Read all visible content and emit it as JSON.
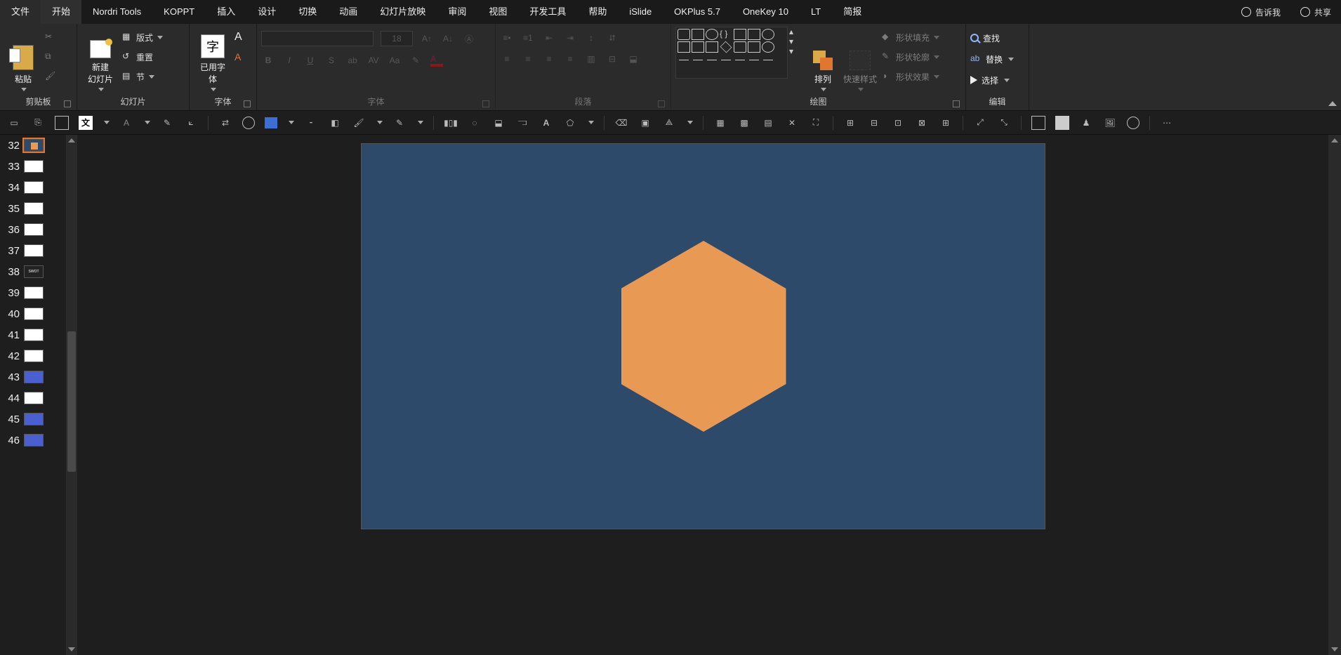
{
  "tabs": {
    "file": "文件",
    "home": "开始",
    "nordri": "Nordri Tools",
    "koppt": "KOPPT",
    "insert": "插入",
    "design": "设计",
    "transition": "切换",
    "animation": "动画",
    "slideshow": "幻灯片放映",
    "review": "审阅",
    "view": "视图",
    "dev": "开发工具",
    "help": "帮助",
    "islide": "iSlide",
    "okplus": "OKPlus 5.7",
    "onekey": "OneKey 10",
    "lt": "LT",
    "brief": "简报"
  },
  "tellme": "告诉我",
  "share": "共享",
  "groups": {
    "clipboard": {
      "label": "剪贴板",
      "paste": "粘贴"
    },
    "slides": {
      "label": "幻灯片",
      "new": "新建\n幻灯片",
      "layout": "版式",
      "reset": "重置",
      "section": "节"
    },
    "fontbox": {
      "label": "字体",
      "used": "已用字\n体"
    },
    "font": {
      "label": "字体",
      "size": "18"
    },
    "para": {
      "label": "段落"
    },
    "draw": {
      "label": "绘图",
      "arrange": "排列",
      "quick": "快速样式",
      "fill": "形状填充",
      "outline": "形状轮廓",
      "effect": "形状效果"
    },
    "edit": {
      "label": "编辑",
      "find": "查找",
      "replace": "替换",
      "select": "选择"
    }
  },
  "thumbs": [
    {
      "n": "32",
      "kind": "dark",
      "sel": true
    },
    {
      "n": "33",
      "kind": "white"
    },
    {
      "n": "34",
      "kind": "white"
    },
    {
      "n": "35",
      "kind": "white"
    },
    {
      "n": "36",
      "kind": "white"
    },
    {
      "n": "37",
      "kind": "white"
    },
    {
      "n": "38",
      "kind": "swot",
      "text": "SWOT"
    },
    {
      "n": "39",
      "kind": "white"
    },
    {
      "n": "40",
      "kind": "white"
    },
    {
      "n": "41",
      "kind": "white"
    },
    {
      "n": "42",
      "kind": "white"
    },
    {
      "n": "43",
      "kind": "blue"
    },
    {
      "n": "44",
      "kind": "white"
    },
    {
      "n": "45",
      "kind": "blue"
    },
    {
      "n": "46",
      "kind": "blue"
    }
  ],
  "tb2": {
    "txt": "文"
  }
}
